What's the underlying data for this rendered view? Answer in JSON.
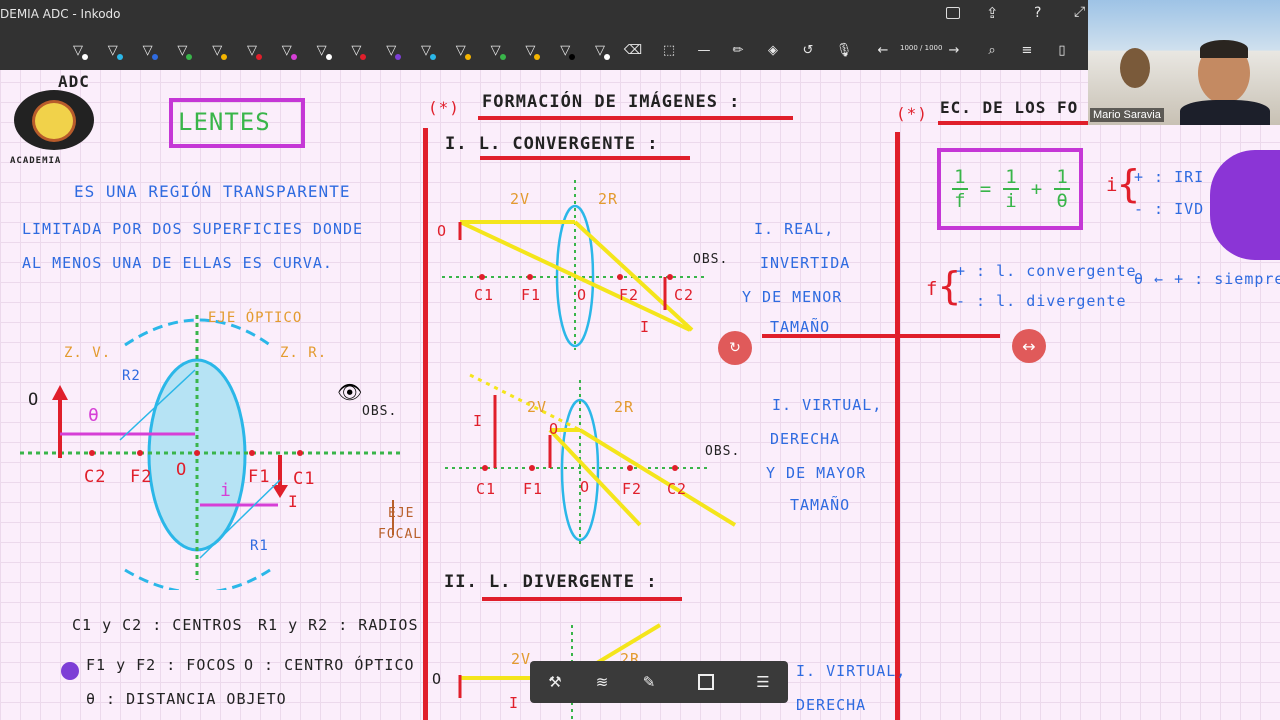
{
  "window": {
    "title": "DEMIA ADC - Inkodo"
  },
  "toolbar": {
    "page_indicator": "1000 / 1000",
    "pen_colors": [
      "#ffffff",
      "#2bb7e8",
      "#2f6be0",
      "#39b54a",
      "#f4b400",
      "#e01f2b",
      "#d63fd6",
      "#ffffff",
      "#e01f2b",
      "#7d3fd6",
      "#2bb7e8",
      "#f4b400",
      "#39b54a",
      "#f4b400",
      "#000000",
      "#ffffff"
    ]
  },
  "video": {
    "name": "Mario Saravia"
  },
  "logo": {
    "text_top": "ADC",
    "text_bottom": "ACADEMIA"
  },
  "lentes": {
    "title": "LENTES",
    "definition": [
      "ES UNA   REGIÓN  TRANSPARENTE",
      "LIMITADA POR DOS SUPERFICIES DONDE",
      "AL MENOS UNA DE ELLAS ES CURVA."
    ],
    "eje_optico": "EJE ÓPTICO",
    "zv": "Z. V.",
    "zr": "Z. R.",
    "r2": "R2",
    "r1": "R1",
    "o": "O",
    "theta": "θ",
    "i": "i",
    "i_label": "I",
    "c2": "C2",
    "f2": "F2",
    "center": "O",
    "f1": "F1",
    "c1": "C1",
    "obs": "OBS.",
    "eje_focal": [
      "EJE",
      "FOCAL"
    ],
    "legend": [
      "C1 y C2 : CENTROS",
      "R1 y R2 : RADIOS",
      "F1 y F2 : FOCOS",
      "O : CENTRO ÓPTICO",
      "θ : DISTANCIA  OBJETO"
    ]
  },
  "formacion": {
    "marker": "(*)",
    "title": "FORMACIÓN DE IMÁGENES :",
    "section1": "I.  L. CONVERGENTE :",
    "d1": {
      "zv": "2V",
      "zr": "2R",
      "o": "O",
      "c1": "C1",
      "f1": "F1",
      "center": "O",
      "f2": "F2",
      "c2": "C2",
      "i": "I",
      "obs": "OBS."
    },
    "d1_text": [
      "I. REAL,",
      "INVERTIDA",
      "Y DE MENOR",
      "TAMAÑO"
    ],
    "d2": {
      "zv": "2V",
      "zr": "2R",
      "i": "I",
      "o": "O",
      "c1": "C1",
      "f1": "F1",
      "center": "O",
      "f2": "F2",
      "c2": "C2",
      "obs": "OBS."
    },
    "d2_text": [
      "I. VIRTUAL,",
      "DERECHA",
      "Y DE MAYOR",
      "TAMAÑO"
    ],
    "section2": "II.  L. DIVERGENTE :",
    "d3": {
      "zv": "2V",
      "zr": "2R",
      "o": "O",
      "i": "I"
    },
    "d3_text": [
      "I. VIRTUAL,",
      "DERECHA"
    ]
  },
  "ecuacion": {
    "marker": "(*)",
    "title": "EC. DE LOS FO",
    "formula": {
      "lhs_num": "1",
      "lhs_den": "f",
      "eq": "=",
      "t1_num": "1",
      "t1_den": "i",
      "plus": "+",
      "t2_num": "1",
      "t2_den": "θ"
    },
    "i_sign": {
      "var": "i",
      "plus": "+ : IRI",
      "minus": "- : IVD"
    },
    "f_sign": {
      "var": "f",
      "plus": "+ : l. convergente",
      "minus": "- : l. divergente"
    },
    "theta_sign": "θ ← + : siempre"
  }
}
